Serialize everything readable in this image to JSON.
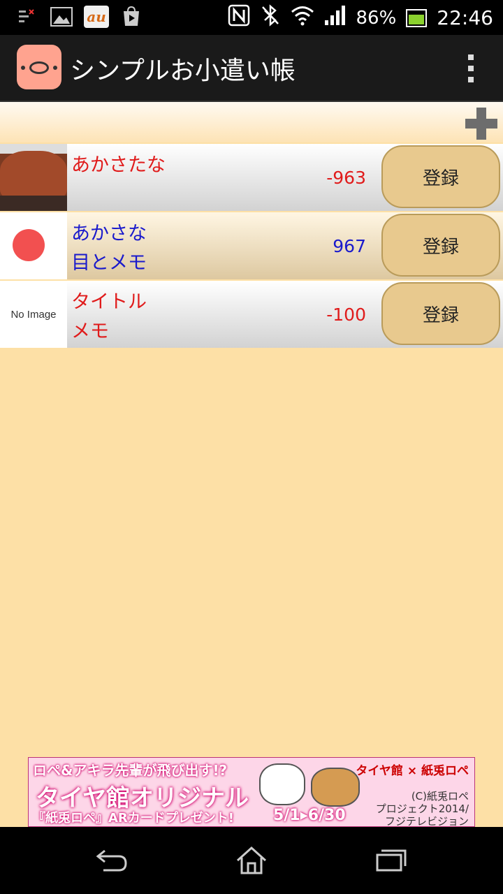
{
  "status_bar": {
    "battery_percent": "86%",
    "time": "22:46",
    "carrier_badge": "au",
    "battery_level": 0.86
  },
  "app": {
    "title": "シンプルお小遣い帳",
    "icon": "pig-icon"
  },
  "toolbar": {
    "add_icon": "plus-icon"
  },
  "entries": [
    {
      "title": "あかさたな",
      "memo": "",
      "amount": "-963",
      "button": "登録",
      "color": "#e01b1b",
      "thumbnail": "capybara-photo"
    },
    {
      "title": "あかさな",
      "memo": "目とメモ",
      "amount": "967",
      "button": "登録",
      "color": "#1a1acc",
      "thumbnail": "red-dot-image"
    },
    {
      "title": "タイトル",
      "memo": "メモ",
      "amount": "-100",
      "button": "登録",
      "color": "#e01b1b",
      "thumbnail_text": "No Image"
    }
  ],
  "ad": {
    "line1": "ロペ&アキラ先輩が飛び出す!?",
    "line2": "タイヤ館オリジナル",
    "line3": "『紙兎ロペ』ARカードプレゼント!",
    "date": "5/1▸6/30",
    "brand": "タイヤ館 × 紙兎ロペ",
    "copyright1": "(C)紙兎ロペ",
    "copyright2": "プロジェクト2014/",
    "copyright3": "フジテレビジョン"
  },
  "colors": {
    "background": "#fde0a6",
    "action_bar": "#1a1a1a",
    "button_fill": "#e8c98e",
    "negative_amount": "#e01b1b",
    "positive_amount": "#1a1acc"
  }
}
